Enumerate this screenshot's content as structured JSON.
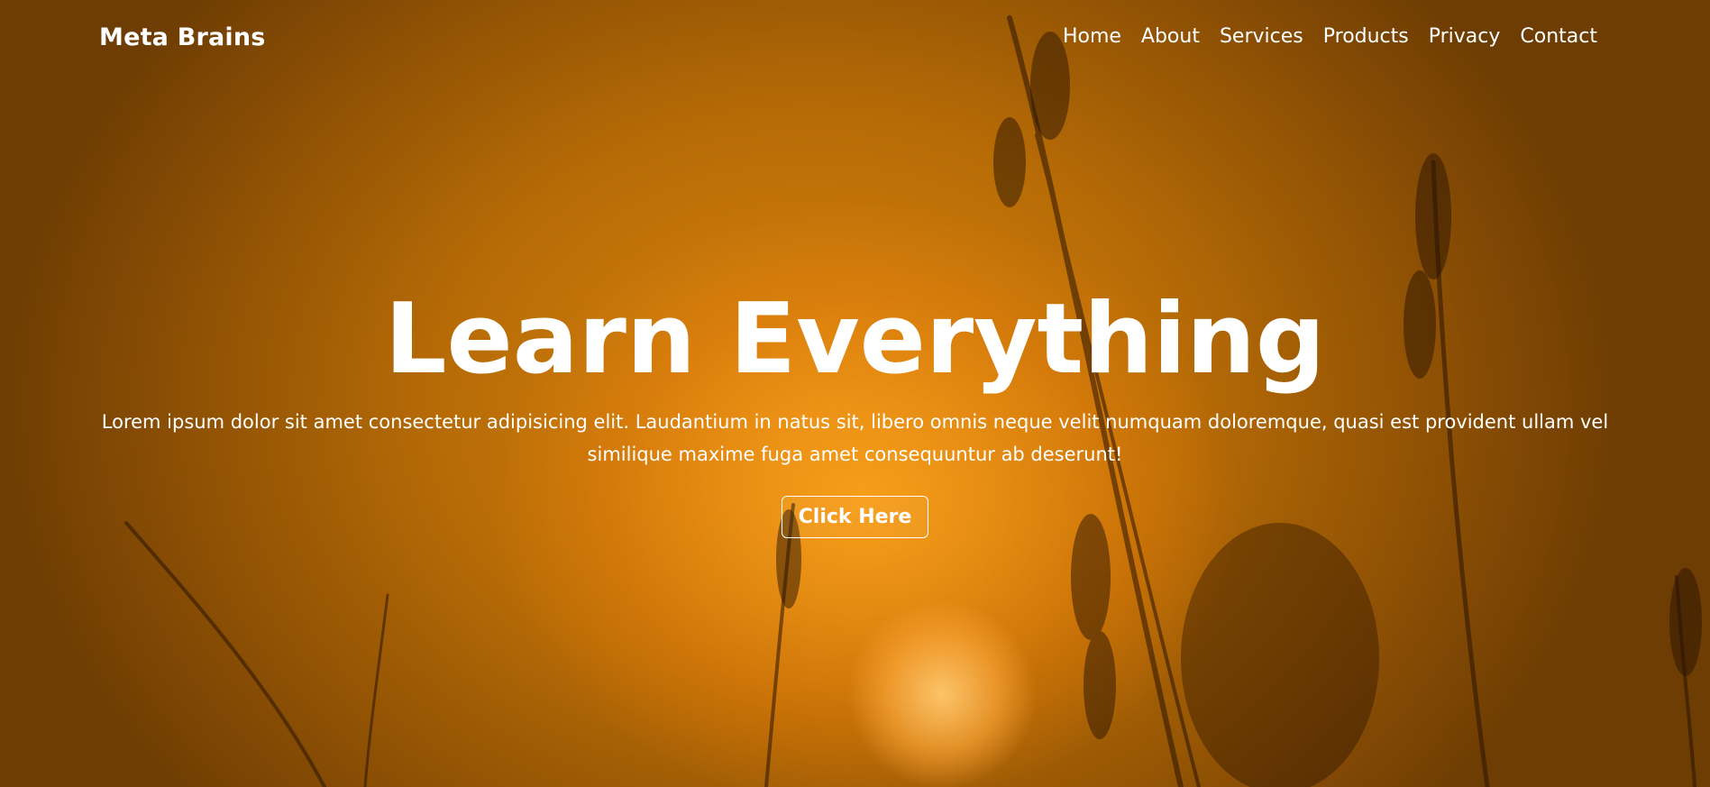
{
  "brand": {
    "name": "Meta Brains"
  },
  "nav": {
    "items": [
      {
        "label": "Home"
      },
      {
        "label": "About"
      },
      {
        "label": "Services"
      },
      {
        "label": "Products"
      },
      {
        "label": "Privacy"
      },
      {
        "label": "Contact"
      }
    ]
  },
  "hero": {
    "title": "Learn Everything",
    "text": "Lorem ipsum dolor sit amet consectetur adipisicing elit. Laudantium in natus sit, libero omnis neque velit numquam doloremque, quasi est provident ullam vel similique maxime fuga amet consequuntur ab deserunt!",
    "button_label": "Click Here",
    "background_image": "blurred-sunset-wheat-silhouette"
  },
  "colors": {
    "text": "#ffffff",
    "background_dark": "#6e3d03",
    "background_mid": "#d78410",
    "sun": "#ffc86e"
  }
}
